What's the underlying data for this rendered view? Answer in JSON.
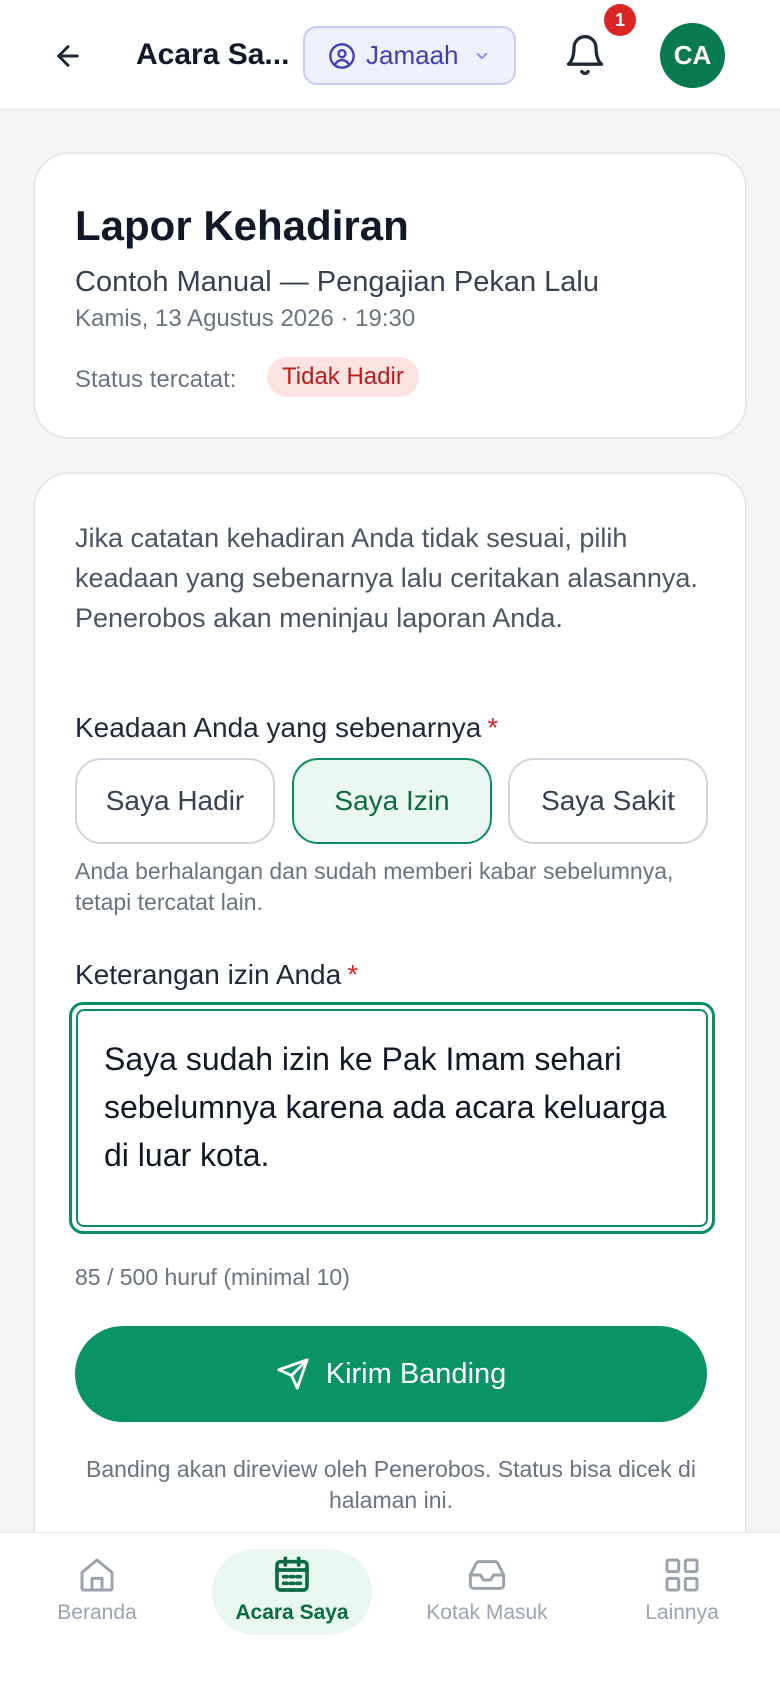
{
  "header": {
    "title": "Acara Sa...",
    "role": "Jamaah",
    "notification_count": "1",
    "avatar_initials": "CA"
  },
  "summary": {
    "heading": "Lapor Kehadiran",
    "event_name": "Contoh Manual — Pengajian Pekan Lalu",
    "event_datetime": "Kamis, 13 Agustus 2026 · 19:30",
    "status_label": "Status tercatat:",
    "status_value": "Tidak Hadir"
  },
  "form": {
    "intro": "Jika catatan kehadiran Anda tidak sesuai, pilih keadaan yang sebenarnya lalu ceritakan alasannya. Penerobos akan meninjau laporan Anda.",
    "state_label": "Keadaan Anda yang sebenarnya",
    "required_mark": "*",
    "options": [
      "Saya Hadir",
      "Saya Izin",
      "Saya Sakit"
    ],
    "selected_option": "Saya Izin",
    "option_hint": "Anda berhalangan dan sudah memberi kabar sebelumnya, tetapi tercatat lain.",
    "reason_label": "Keterangan izin Anda",
    "reason_value": "Saya sudah izin ke Pak Imam sehari sebelumnya karena ada acara keluarga di luar kota.",
    "counter": "85 / 500 huruf (minimal 10)",
    "submit_label": "Kirim Banding",
    "footnote": "Banding akan direview oleh Penerobos. Status bisa dicek di halaman ini."
  },
  "bottom_nav": {
    "items": [
      {
        "label": "Beranda",
        "icon": "home-icon"
      },
      {
        "label": "Acara Saya",
        "icon": "calendar-icon",
        "active": true
      },
      {
        "label": "Kotak Masuk",
        "icon": "inbox-icon"
      },
      {
        "label": "Lainnya",
        "icon": "grid-icon"
      }
    ]
  },
  "colors": {
    "primary": "#0a9464",
    "primary_dark": "#0a6b44",
    "danger": "#dc2626",
    "role_accent": "#3f3fb5"
  }
}
